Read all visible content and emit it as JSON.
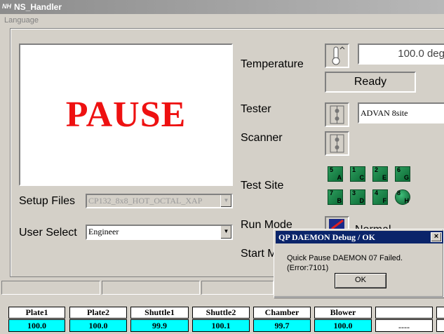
{
  "window": {
    "title": "NS_Handler",
    "icon": "app-logo-icon",
    "icon_text": "NH"
  },
  "menu": {
    "language": "Language"
  },
  "status_panel": {
    "text": "PAUSE",
    "color": "#ee1111"
  },
  "setup_files": {
    "label": "Setup Files",
    "value": "CP132_8x8_HOT_OCTAL_XAP"
  },
  "user_select": {
    "label": "User Select",
    "value": "Engineer"
  },
  "temperature": {
    "label": "Temperature",
    "value": "100.0 deg",
    "status": "Ready"
  },
  "tester": {
    "label": "Tester",
    "value": "ADVAN 8site"
  },
  "scanner": {
    "label": "Scanner"
  },
  "test_site": {
    "label": "Test Site",
    "sites": [
      {
        "num": "5",
        "letter": "A"
      },
      {
        "num": "1",
        "letter": "C"
      },
      {
        "num": "2",
        "letter": "E"
      },
      {
        "num": "6",
        "letter": "G"
      },
      {
        "num": "7",
        "letter": "B"
      },
      {
        "num": "3",
        "letter": "D"
      },
      {
        "num": "4",
        "letter": "F"
      },
      {
        "num": "8",
        "letter": "H"
      }
    ]
  },
  "run_mode": {
    "label": "Run Mode",
    "value": "Normal"
  },
  "start_mode": {
    "label": "Start M"
  },
  "readings": {
    "headers": [
      "Plate1",
      "Plate2",
      "Shuttle1",
      "Shuttle2",
      "Chamber",
      "Blower",
      "",
      ""
    ],
    "values": [
      "100.0",
      "100.0",
      "99.9",
      "100.1",
      "99.7",
      "100.0",
      "----",
      ""
    ]
  },
  "dialog": {
    "title": "QP DAEMON Debug / OK",
    "message": "Quick Pause DAEMON 07 Failed. (Error:7101)",
    "ok": "OK",
    "close": "×"
  }
}
